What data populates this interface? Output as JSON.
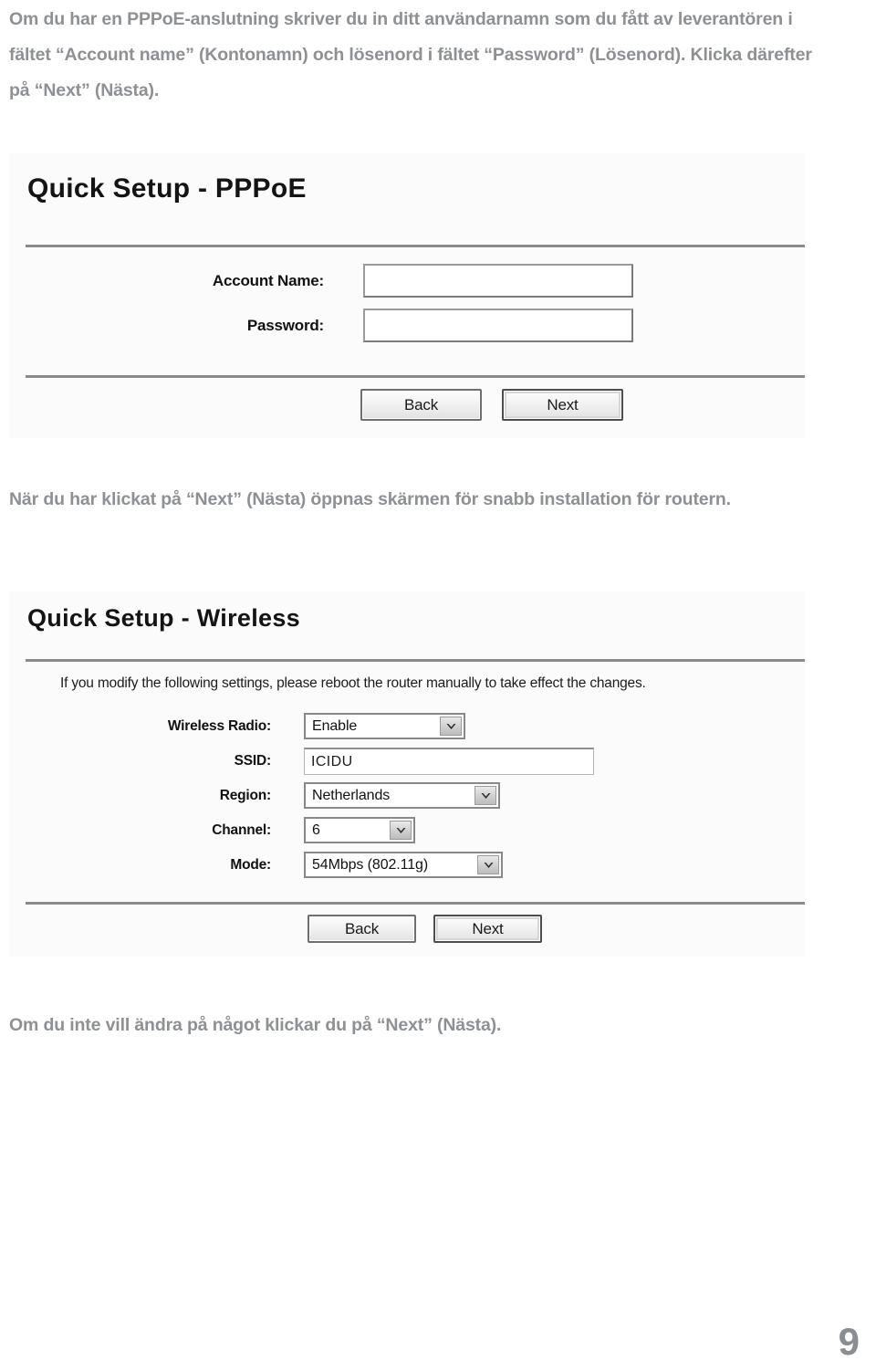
{
  "page": {
    "number": "9"
  },
  "paragraphs": {
    "intro": "Om du har en PPPoE-anslutning skriver du in ditt användarnamn som du fått av leverantören i fältet “Account name” (Kontonamn) och lösenord i fältet “Password” (Lösenord). Klicka därefter på “Next” (Nästa).",
    "middle": "När du har klickat på “Next” (Nästa) öppnas skärmen för snabb installation för routern.",
    "bottom": "Om du inte vill ändra på något klickar du på “Next” (Nästa)."
  },
  "pppoe_screen": {
    "title": "Quick Setup - PPPoE",
    "fields": [
      {
        "label": "Account Name:",
        "value": "",
        "type": "text"
      },
      {
        "label": "Password:",
        "value": "",
        "type": "text"
      }
    ],
    "buttons": [
      {
        "label": "Back",
        "focused": false
      },
      {
        "label": "Next",
        "focused": true
      }
    ]
  },
  "wireless_screen": {
    "title": "Quick Setup - Wireless",
    "note": "If you modify the following settings, please reboot the router manually to take effect the changes.",
    "fields": [
      {
        "label": "Wireless Radio:",
        "value": "Enable",
        "type": "select"
      },
      {
        "label": "SSID:",
        "value": "ICIDU",
        "type": "text"
      },
      {
        "label": "Region:",
        "value": "Netherlands",
        "type": "select"
      },
      {
        "label": "Channel:",
        "value": "6",
        "type": "select"
      },
      {
        "label": "Mode:",
        "value": "54Mbps (802.11g)",
        "type": "select"
      }
    ],
    "buttons": [
      {
        "label": "Back",
        "focused": false
      },
      {
        "label": "Next",
        "focused": true
      }
    ]
  },
  "colors": {
    "body_text": "#8d9094",
    "screenshot_bg": "#fbfbfb",
    "rule": "#8a8a8a",
    "page_number": "#8a8d91"
  },
  "icons": {
    "dropdown_arrow": "chevron-down-icon"
  }
}
